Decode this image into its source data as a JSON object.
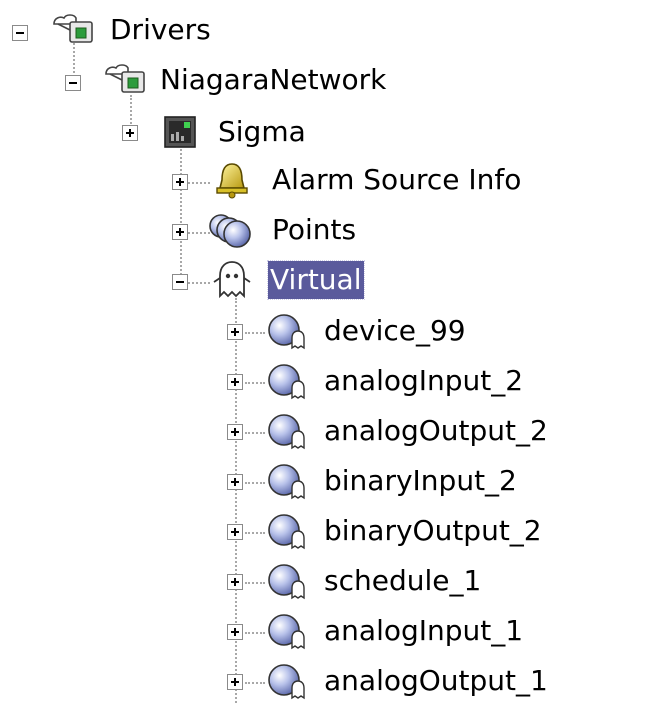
{
  "tree": {
    "drivers": {
      "label": "Drivers",
      "icon": "network-folder-icon",
      "expanded": true
    },
    "niagara_network": {
      "label": "NiagaraNetwork",
      "icon": "network-folder-icon",
      "expanded": true
    },
    "sigma": {
      "label": "Sigma",
      "icon": "station-device-icon",
      "expanded": false
    },
    "alarm_source_info": {
      "label": "Alarm Source Info",
      "icon": "bell-icon",
      "expanded": false
    },
    "points": {
      "label": "Points",
      "icon": "points-icon",
      "expanded": false
    },
    "virtual": {
      "label": "Virtual",
      "icon": "ghost-icon",
      "expanded": true,
      "selected": true
    },
    "virtual_children": [
      {
        "label": "device_99",
        "icon": "virtual-point-icon"
      },
      {
        "label": "analogInput_2",
        "icon": "virtual-point-icon"
      },
      {
        "label": "analogOutput_2",
        "icon": "virtual-point-icon"
      },
      {
        "label": "binaryInput_2",
        "icon": "virtual-point-icon"
      },
      {
        "label": "binaryOutput_2",
        "icon": "virtual-point-icon"
      },
      {
        "label": "schedule_1",
        "icon": "virtual-point-icon"
      },
      {
        "label": "analogInput_1",
        "icon": "virtual-point-icon"
      },
      {
        "label": "analogOutput_1",
        "icon": "virtual-point-icon"
      }
    ]
  },
  "colors": {
    "selection": "#5a5a9c",
    "tree_lines": "#a8a8a8",
    "point_icon": "#9aa8dc",
    "bell_icon": "#d8c028"
  }
}
